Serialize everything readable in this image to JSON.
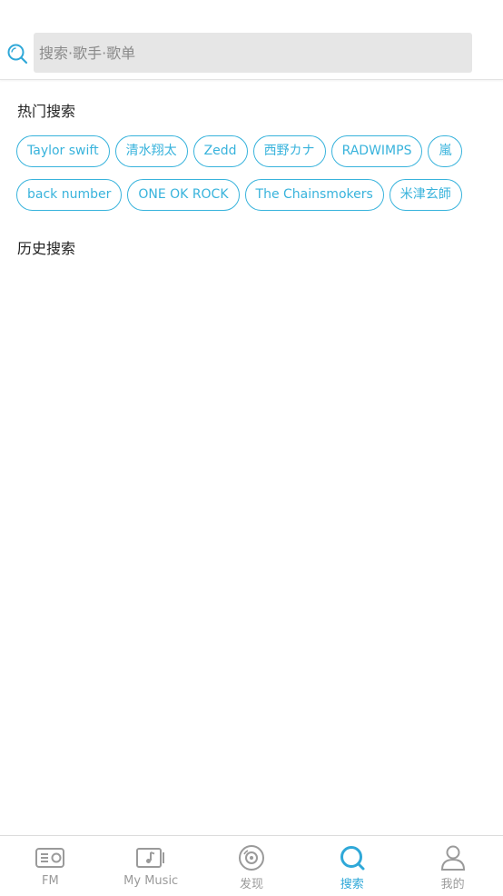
{
  "search": {
    "placeholder": "搜索·歌手·歌单",
    "value": ""
  },
  "hot_search": {
    "title": "热门搜索",
    "rows": [
      [
        "Taylor swift",
        "清水翔太",
        "Zedd",
        "西野カナ",
        "RADWIMPS",
        "嵐"
      ],
      [
        "back number",
        "ONE OK ROCK",
        "The Chainsmokers",
        "米津玄師"
      ]
    ]
  },
  "history_search": {
    "title": "历史搜索"
  },
  "bottom_nav": {
    "items": [
      {
        "label": "FM",
        "icon": "radio-icon"
      },
      {
        "label": "My Music",
        "icon": "music-note-icon"
      },
      {
        "label": "发现",
        "icon": "disc-icon"
      },
      {
        "label": "搜索",
        "icon": "search-icon"
      },
      {
        "label": "我的",
        "icon": "user-icon"
      }
    ],
    "active_index": 3
  },
  "colors": {
    "accent": "#38b3dc",
    "nav_active": "#2fa8d8",
    "nav_inactive": "#9a9a9a",
    "search_bg": "#e6e6e6"
  }
}
